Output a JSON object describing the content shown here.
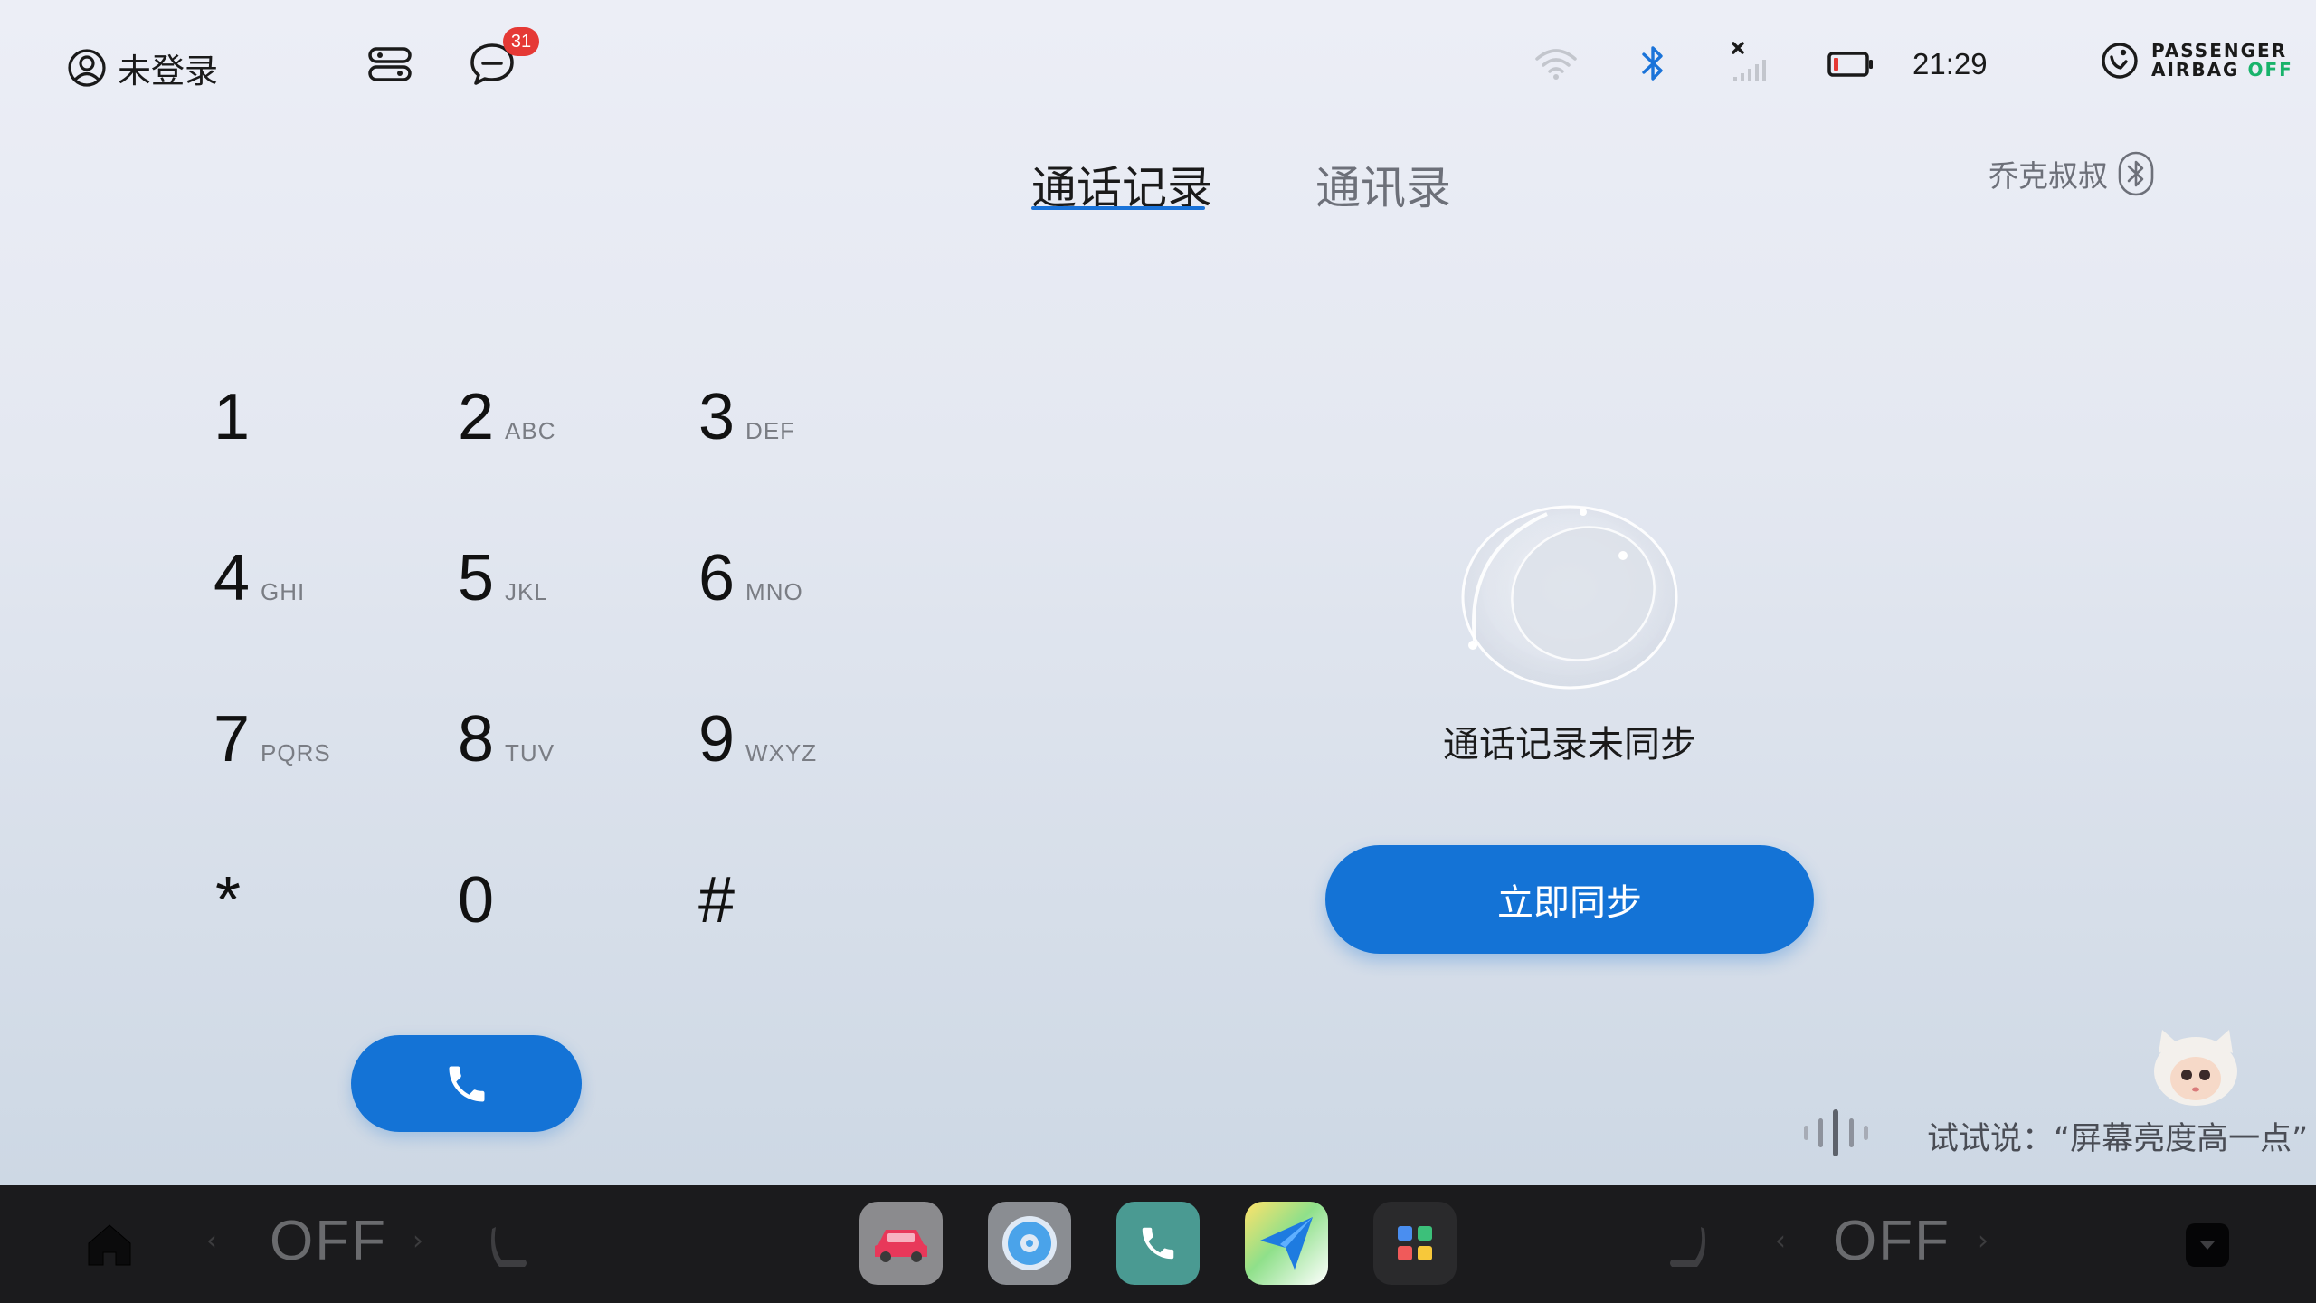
{
  "status_bar": {
    "account_label": "未登录",
    "notification_count": "31",
    "time": "21:29",
    "airbag_line1": "PASSENGER",
    "airbag_line2": "AIRBAG",
    "airbag_state": "OFF"
  },
  "tabs": [
    {
      "label": "通话记录",
      "active": true
    },
    {
      "label": "通讯录",
      "active": false
    }
  ],
  "device": {
    "name": "乔克叔叔"
  },
  "dialpad": {
    "keys": [
      {
        "digit": "1",
        "letters": ""
      },
      {
        "digit": "2",
        "letters": "ABC"
      },
      {
        "digit": "3",
        "letters": "DEF"
      },
      {
        "digit": "4",
        "letters": "GHI"
      },
      {
        "digit": "5",
        "letters": "JKL"
      },
      {
        "digit": "6",
        "letters": "MNO"
      },
      {
        "digit": "7",
        "letters": "PQRS"
      },
      {
        "digit": "8",
        "letters": "TUV"
      },
      {
        "digit": "9",
        "letters": "WXYZ"
      },
      {
        "digit": "*",
        "letters": ""
      },
      {
        "digit": "0",
        "letters": ""
      },
      {
        "digit": "#",
        "letters": ""
      }
    ]
  },
  "sync": {
    "title": "通话记录未同步",
    "button_label": "立即同步"
  },
  "voice": {
    "hint": "试试说：“屏幕亮度高一点”"
  },
  "dock": {
    "left_climate": "OFF",
    "right_climate": "OFF",
    "apps": [
      "car-app",
      "music-app",
      "phone-app",
      "navigation-app",
      "app-launcher"
    ]
  },
  "colors": {
    "accent": "#1473d6",
    "badge": "#e53935",
    "airbag_off": "#18b36b",
    "dock_bg": "#1b1b1d"
  }
}
